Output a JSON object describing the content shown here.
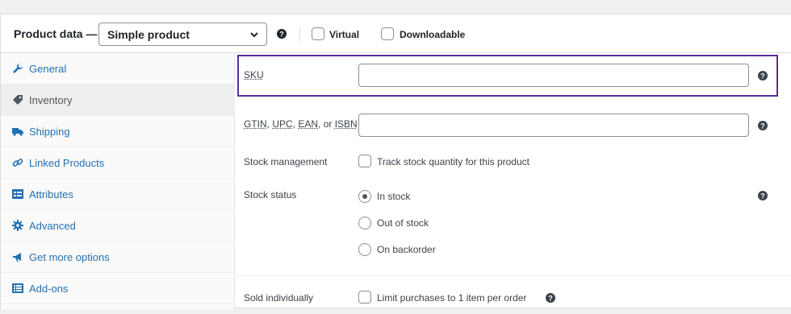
{
  "header": {
    "title": "Product data —",
    "product_type": "Simple product",
    "virtual_label": "Virtual",
    "downloadable_label": "Downloadable"
  },
  "sidebar": {
    "items": [
      {
        "label": "General",
        "icon": "wrench-icon"
      },
      {
        "label": "Inventory",
        "icon": "tag-icon",
        "active": true
      },
      {
        "label": "Shipping",
        "icon": "truck-icon"
      },
      {
        "label": "Linked Products",
        "icon": "link-icon"
      },
      {
        "label": "Attributes",
        "icon": "table-icon"
      },
      {
        "label": "Advanced",
        "icon": "gear-icon"
      },
      {
        "label": "Get more options",
        "icon": "megaphone-icon"
      },
      {
        "label": "Add-ons",
        "icon": "list-icon"
      }
    ]
  },
  "fields": {
    "sku": {
      "label": "SKU",
      "value": ""
    },
    "gtin": {
      "label_parts": [
        "GTIN",
        ", ",
        "UPC",
        ", ",
        "EAN",
        ", or ",
        "ISBN"
      ],
      "value": ""
    },
    "stock_management": {
      "label": "Stock management",
      "checkbox_label": "Track stock quantity for this product",
      "checked": false
    },
    "stock_status": {
      "label": "Stock status",
      "options": [
        "In stock",
        "Out of stock",
        "On backorder"
      ],
      "selected": "In stock"
    },
    "sold_individually": {
      "label": "Sold individually",
      "checkbox_label": "Limit purchases to 1 item per order",
      "checked": false
    }
  },
  "colors": {
    "link": "#2271b1",
    "focus_border": "#5b2c9e",
    "border": "#dcdcde"
  }
}
